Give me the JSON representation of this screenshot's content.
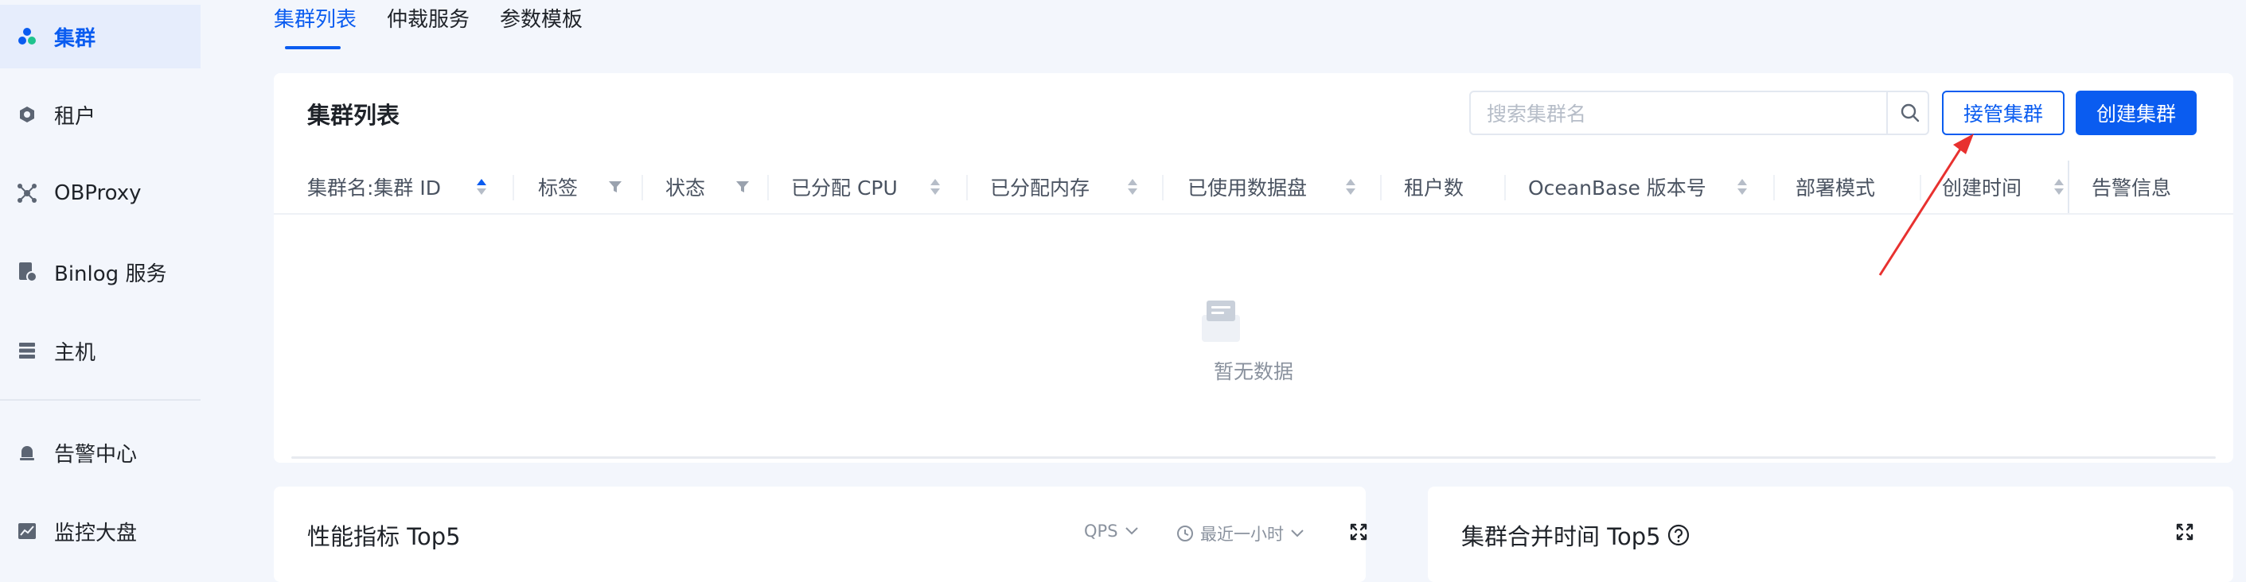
{
  "sidebar": {
    "items": [
      {
        "label": "集群",
        "icon": "cluster-icon"
      },
      {
        "label": "租户",
        "icon": "tenant-icon"
      },
      {
        "label": "OBProxy",
        "icon": "obproxy-icon"
      },
      {
        "label": "Binlog 服务",
        "icon": "binlog-icon"
      },
      {
        "label": "主机",
        "icon": "host-icon"
      },
      {
        "label": "告警中心",
        "icon": "alarm-icon"
      },
      {
        "label": "监控大盘",
        "icon": "monitor-icon"
      }
    ],
    "active_color": "#0a5cf0"
  },
  "tabs": [
    {
      "label": "集群列表"
    },
    {
      "label": "仲裁服务"
    },
    {
      "label": "参数模板"
    }
  ],
  "cluster_list": {
    "title": "集群列表",
    "search_placeholder": "搜索集群名",
    "takeover_button": "接管集群",
    "create_button": "创建集群",
    "columns": [
      {
        "label": "集群名:集群 ID",
        "control": "sort-active"
      },
      {
        "label": "标签",
        "control": "filter"
      },
      {
        "label": "状态",
        "control": "filter"
      },
      {
        "label": "已分配 CPU",
        "control": "sort"
      },
      {
        "label": "已分配内存",
        "control": "sort"
      },
      {
        "label": "已使用数据盘",
        "control": "sort"
      },
      {
        "label": "租户数",
        "control": "none"
      },
      {
        "label": "OceanBase 版本号",
        "control": "sort"
      },
      {
        "label": "部署模式",
        "control": "none"
      },
      {
        "label": "创建时间",
        "control": "sort"
      },
      {
        "label": "告警信息",
        "control": "none"
      }
    ],
    "empty_text": "暂无数据"
  },
  "performance_card": {
    "title": "性能指标 Top5",
    "metric_select": "QPS",
    "time_select": "最近一小时"
  },
  "merge_card": {
    "title": "集群合并时间 Top5"
  },
  "colors": {
    "primary": "#0a5cf0",
    "background": "#f3f6fc",
    "annotation_arrow": "#e8312f"
  }
}
